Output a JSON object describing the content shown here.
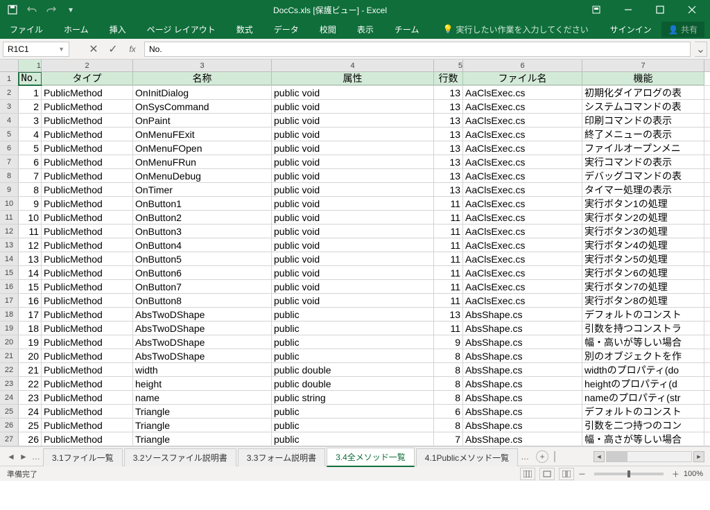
{
  "title": "DocCs.xls [保護ビュー] - Excel",
  "ribbon": {
    "file": "ファイル",
    "home": "ホーム",
    "insert": "挿入",
    "pageLayout": "ページ レイアウト",
    "formulas": "数式",
    "data": "データ",
    "review": "校閲",
    "view": "表示",
    "team": "チーム",
    "tell": "実行したい作業を入力してください",
    "signin": "サインイン",
    "share": "共有"
  },
  "namebox": "R1C1",
  "formula": "No.",
  "headers": {
    "c1": "No.",
    "c2": "タイプ",
    "c3": "名称",
    "c4": "属性",
    "c5": "行数",
    "c6": "ファイル名",
    "c7": "機能"
  },
  "rows": [
    {
      "n": "1",
      "t": "PublicMethod",
      "name": "OnInitDialog",
      "attr": "public void",
      "lines": "13",
      "file": "AaClsExec.cs",
      "desc": "初期化ダイアログの表"
    },
    {
      "n": "2",
      "t": "PublicMethod",
      "name": "OnSysCommand",
      "attr": "public void",
      "lines": "13",
      "file": "AaClsExec.cs",
      "desc": "システムコマンドの表"
    },
    {
      "n": "3",
      "t": "PublicMethod",
      "name": "OnPaint",
      "attr": "public void",
      "lines": "13",
      "file": "AaClsExec.cs",
      "desc": "印刷コマンドの表示"
    },
    {
      "n": "4",
      "t": "PublicMethod",
      "name": "OnMenuFExit",
      "attr": "public void",
      "lines": "13",
      "file": "AaClsExec.cs",
      "desc": "終了メニューの表示"
    },
    {
      "n": "5",
      "t": "PublicMethod",
      "name": "OnMenuFOpen",
      "attr": "public void",
      "lines": "13",
      "file": "AaClsExec.cs",
      "desc": "ファイルオープンメニ"
    },
    {
      "n": "6",
      "t": "PublicMethod",
      "name": "OnMenuFRun",
      "attr": "public void",
      "lines": "13",
      "file": "AaClsExec.cs",
      "desc": "実行コマンドの表示"
    },
    {
      "n": "7",
      "t": "PublicMethod",
      "name": "OnMenuDebug",
      "attr": "public void",
      "lines": "13",
      "file": "AaClsExec.cs",
      "desc": "デバッグコマンドの表"
    },
    {
      "n": "8",
      "t": "PublicMethod",
      "name": "OnTimer",
      "attr": "public void",
      "lines": "13",
      "file": "AaClsExec.cs",
      "desc": "タイマー処理の表示"
    },
    {
      "n": "9",
      "t": "PublicMethod",
      "name": "OnButton1",
      "attr": "public void",
      "lines": "11",
      "file": "AaClsExec.cs",
      "desc": "実行ボタン1の処理"
    },
    {
      "n": "10",
      "t": "PublicMethod",
      "name": "OnButton2",
      "attr": "public void",
      "lines": "11",
      "file": "AaClsExec.cs",
      "desc": "実行ボタン2の処理"
    },
    {
      "n": "11",
      "t": "PublicMethod",
      "name": "OnButton3",
      "attr": "public void",
      "lines": "11",
      "file": "AaClsExec.cs",
      "desc": "実行ボタン3の処理"
    },
    {
      "n": "12",
      "t": "PublicMethod",
      "name": "OnButton4",
      "attr": "public void",
      "lines": "11",
      "file": "AaClsExec.cs",
      "desc": "実行ボタン4の処理"
    },
    {
      "n": "13",
      "t": "PublicMethod",
      "name": "OnButton5",
      "attr": "public void",
      "lines": "11",
      "file": "AaClsExec.cs",
      "desc": "実行ボタン5の処理"
    },
    {
      "n": "14",
      "t": "PublicMethod",
      "name": "OnButton6",
      "attr": "public void",
      "lines": "11",
      "file": "AaClsExec.cs",
      "desc": "実行ボタン6の処理"
    },
    {
      "n": "15",
      "t": "PublicMethod",
      "name": "OnButton7",
      "attr": "public void",
      "lines": "11",
      "file": "AaClsExec.cs",
      "desc": "実行ボタン7の処理"
    },
    {
      "n": "16",
      "t": "PublicMethod",
      "name": "OnButton8",
      "attr": "public void",
      "lines": "11",
      "file": "AaClsExec.cs",
      "desc": "実行ボタン8の処理"
    },
    {
      "n": "17",
      "t": "PublicMethod",
      "name": "AbsTwoDShape",
      "attr": "public",
      "lines": "13",
      "file": "AbsShape.cs",
      "desc": "デフォルトのコンスト"
    },
    {
      "n": "18",
      "t": "PublicMethod",
      "name": "AbsTwoDShape",
      "attr": "public",
      "lines": "11",
      "file": "AbsShape.cs",
      "desc": "引数を持つコンストラ"
    },
    {
      "n": "19",
      "t": "PublicMethod",
      "name": "AbsTwoDShape",
      "attr": "public",
      "lines": "9",
      "file": "AbsShape.cs",
      "desc": "幅・高いが等しい場合"
    },
    {
      "n": "20",
      "t": "PublicMethod",
      "name": "AbsTwoDShape",
      "attr": "public",
      "lines": "8",
      "file": "AbsShape.cs",
      "desc": "別のオブジェクトを作"
    },
    {
      "n": "21",
      "t": "PublicMethod",
      "name": "width",
      "attr": "public double",
      "lines": "8",
      "file": "AbsShape.cs",
      "desc": "widthのプロパティ(do"
    },
    {
      "n": "22",
      "t": "PublicMethod",
      "name": "height",
      "attr": "public double",
      "lines": "8",
      "file": "AbsShape.cs",
      "desc": "heightのプロパティ(d"
    },
    {
      "n": "23",
      "t": "PublicMethod",
      "name": "name",
      "attr": "public string",
      "lines": "8",
      "file": "AbsShape.cs",
      "desc": "nameのプロパティ(str"
    },
    {
      "n": "24",
      "t": "PublicMethod",
      "name": "Triangle",
      "attr": "public",
      "lines": "6",
      "file": "AbsShape.cs",
      "desc": "デフォルトのコンスト"
    },
    {
      "n": "25",
      "t": "PublicMethod",
      "name": "Triangle",
      "attr": "public",
      "lines": "8",
      "file": "AbsShape.cs",
      "desc": "引数を二つ持つのコン"
    },
    {
      "n": "26",
      "t": "PublicMethod",
      "name": "Triangle",
      "attr": "public",
      "lines": "7",
      "file": "AbsShape.cs",
      "desc": "幅・高さが等しい場合"
    }
  ],
  "tabs": {
    "t1": "3.1ファイル一覧",
    "t2": "3.2ソースファイル説明書",
    "t3": "3.3フォーム説明書",
    "t4": "3.4全メソッド一覧",
    "t5": "4.1Publicメソッド一覧"
  },
  "status": {
    "ready": "準備完了",
    "zoom": "100%"
  },
  "cols": [
    "1",
    "2",
    "3",
    "4",
    "5",
    "6",
    "7"
  ]
}
